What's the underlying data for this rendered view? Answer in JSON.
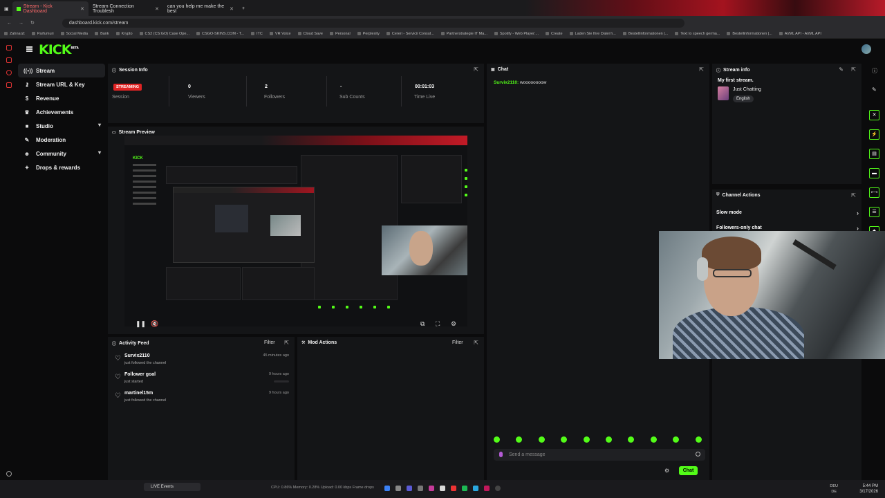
{
  "browser": {
    "tabs": [
      {
        "label": "Stream - Kick Dashboard",
        "active": true
      },
      {
        "label": "Stream Connection Troublesh",
        "active": false
      },
      {
        "label": "can you help me make the best",
        "active": false
      }
    ],
    "new_tab": "+",
    "url": "dashboard.kick.com/stream",
    "bookmarks": [
      "Zahnarzt",
      "Parfumuri",
      "Social Media",
      "Bank",
      "Krypto",
      "CS2 (CS:GO) Case Ope...",
      "CSGO-SKINS.COM - T...",
      "ITC",
      "VR Voice",
      "Cloud Save",
      "Personal",
      "Perplexity",
      "Cereri - Servicii Consul...",
      "Partnerstrategie IT Ma...",
      "Spotify - Web Player:...",
      "Create",
      "Laden Sie Ihre Datei h...",
      "Bestellinformationen |...",
      "Text to speech germa...",
      "Bestellinformationen |...",
      "AI/ML API - AI/ML API"
    ]
  },
  "app": {
    "logo": "KICK",
    "logo_sup": "BETA",
    "accent": "#53fc18"
  },
  "sidebar": {
    "items": [
      {
        "label": "Stream",
        "icon": "broadcast-icon",
        "glyph": "((•))",
        "active": true,
        "chevron": false
      },
      {
        "label": "Stream URL & Key",
        "icon": "key-icon",
        "glyph": "⚷",
        "active": false,
        "chevron": false
      },
      {
        "label": "Revenue",
        "icon": "dollar-icon",
        "glyph": "$",
        "active": false,
        "chevron": false
      },
      {
        "label": "Achievements",
        "icon": "trophy-icon",
        "glyph": "♛",
        "active": false,
        "chevron": false
      },
      {
        "label": "Studio",
        "icon": "studio-icon",
        "glyph": "■",
        "active": false,
        "chevron": true
      },
      {
        "label": "Moderation",
        "icon": "hammer-icon",
        "glyph": "✎",
        "active": false,
        "chevron": false
      },
      {
        "label": "Community",
        "icon": "people-icon",
        "glyph": "☻",
        "active": false,
        "chevron": true
      },
      {
        "label": "Drops & rewards",
        "icon": "gift-icon",
        "glyph": "✦",
        "active": false,
        "chevron": false
      }
    ]
  },
  "session_info": {
    "title": "Session Info",
    "badge": "STREAMING",
    "badge_sub": "Session",
    "stats": [
      {
        "value": "0",
        "label": "Viewers"
      },
      {
        "value": "2",
        "label": "Followers"
      },
      {
        "value": "-",
        "label": "Sub Counts"
      },
      {
        "value": "00:01:03",
        "label": "Time Live"
      }
    ]
  },
  "stream_preview": {
    "title": "Stream Preview"
  },
  "activity_feed": {
    "title": "Activity Feed",
    "filter": "Filter",
    "items": [
      {
        "name": "Survix2110",
        "sub": "just followed the channel",
        "time": "45 minutes ago",
        "progress": false
      },
      {
        "name": "Follower goal",
        "sub": "just started",
        "time": "9 hours ago",
        "progress": true
      },
      {
        "name": "martinel15m",
        "sub": "just followed the channel",
        "time": "9 hours ago",
        "progress": false
      }
    ]
  },
  "mod_actions": {
    "title": "Mod Actions",
    "filter": "Filter"
  },
  "chat": {
    "title": "Chat",
    "messages": [
      {
        "user": "Survix2110:",
        "text": "woooooooow"
      }
    ],
    "placeholder": "Send a message",
    "send_label": "Chat"
  },
  "stream_info": {
    "title": "Stream info",
    "stream_title": "My first stream.",
    "category": "Just Chatting",
    "tag": "English"
  },
  "channel_actions": {
    "title": "Channel Actions",
    "rows": [
      "Slow mode",
      "Followers-only chat"
    ]
  },
  "taskbar": {
    "live_events": "LIVE Events",
    "stats": "CPU: 0.86%     Memory: 0.28%     Upload: 0.00 kbps     Frame drops",
    "lang_top": "DEU",
    "lang_bottom": "DE",
    "time": "5:44 PM",
    "date": "3/17/2026"
  }
}
